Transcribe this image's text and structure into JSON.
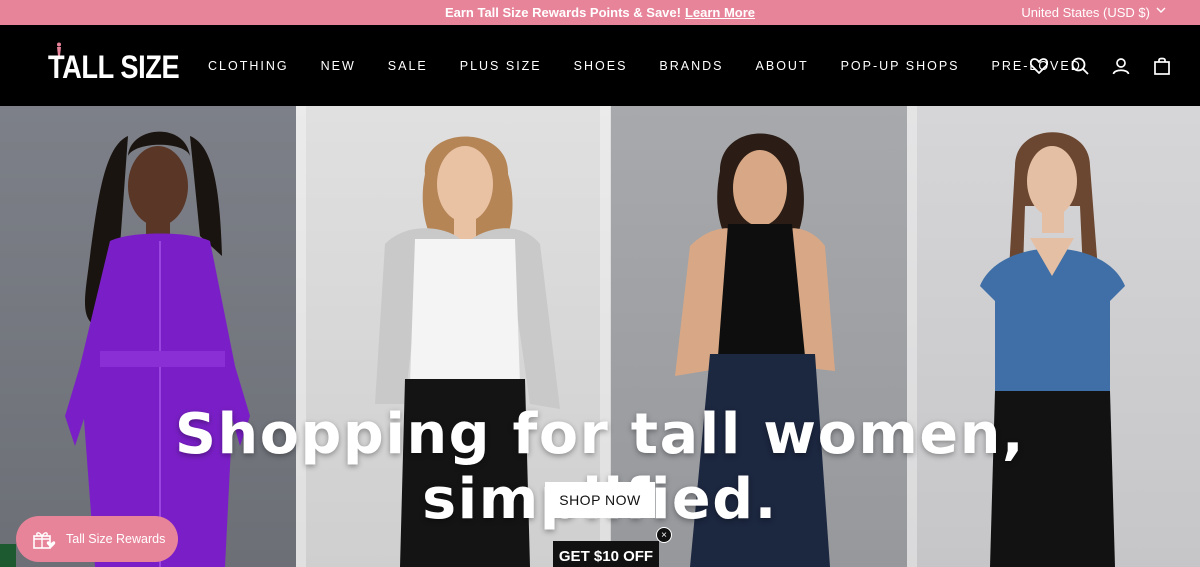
{
  "announcement": {
    "text": "Earn Tall Size Rewards Points & Save!",
    "link": "Learn More"
  },
  "currency": "United States (USD $)",
  "brand": {
    "logo": "TALL SIZE"
  },
  "nav": [
    "CLOTHING",
    "NEW",
    "SALE",
    "PLUS SIZE",
    "SHOES",
    "BRANDS",
    "ABOUT",
    "POP-UP SHOPS",
    "PRE-LOVED"
  ],
  "icons": [
    "heart-icon",
    "search-icon",
    "account-icon",
    "bag-icon"
  ],
  "hero": {
    "title": "Shopping for tall women, simplified.",
    "cta": "SHOP NOW"
  },
  "promo": {
    "label": "GET $10 OFF",
    "close": "×"
  },
  "rewards": {
    "label": "Tall Size Rewards"
  },
  "colors": {
    "accent": "#e8849a",
    "header": "#000000"
  }
}
